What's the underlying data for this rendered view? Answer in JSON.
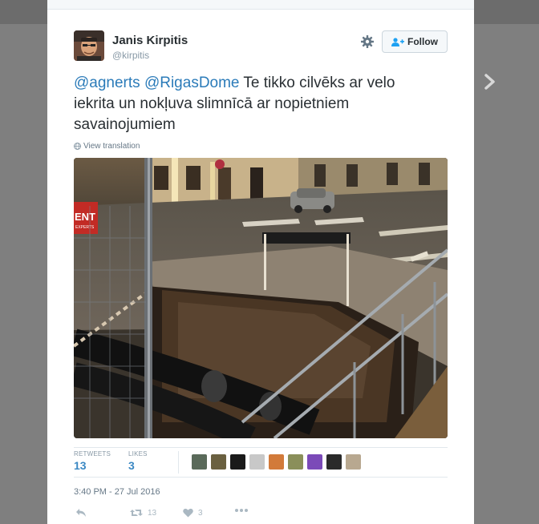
{
  "tweet": {
    "author_name": "Janis Kirpitis",
    "author_handle": "@kirpitis",
    "follow_label": "Follow",
    "mention_1": "@agnerts",
    "mention_2": "@RigasDome",
    "text": " Te tikko cilvēks ar velo iekrita un nokļuva slimnīcā ar nopietniem savainojumiem",
    "view_translation": "View translation",
    "timestamp": "3:40 PM - 27 Jul 2016"
  },
  "photo_sign_text": "ENT",
  "photo_sign_subtext": "EXPERTS",
  "stats": {
    "retweets_label": "RETWEETS",
    "retweets_count": "13",
    "likes_label": "LIKES",
    "likes_count": "3"
  },
  "actions": {
    "reply_icon": "reply-icon",
    "retweet_count": "13",
    "like_count": "3",
    "more_icon": "more-icon"
  },
  "colors": {
    "link": "#2b7bb9",
    "stat_number": "#3b88c3",
    "text": "#292f33",
    "muted": "#8899a6"
  }
}
